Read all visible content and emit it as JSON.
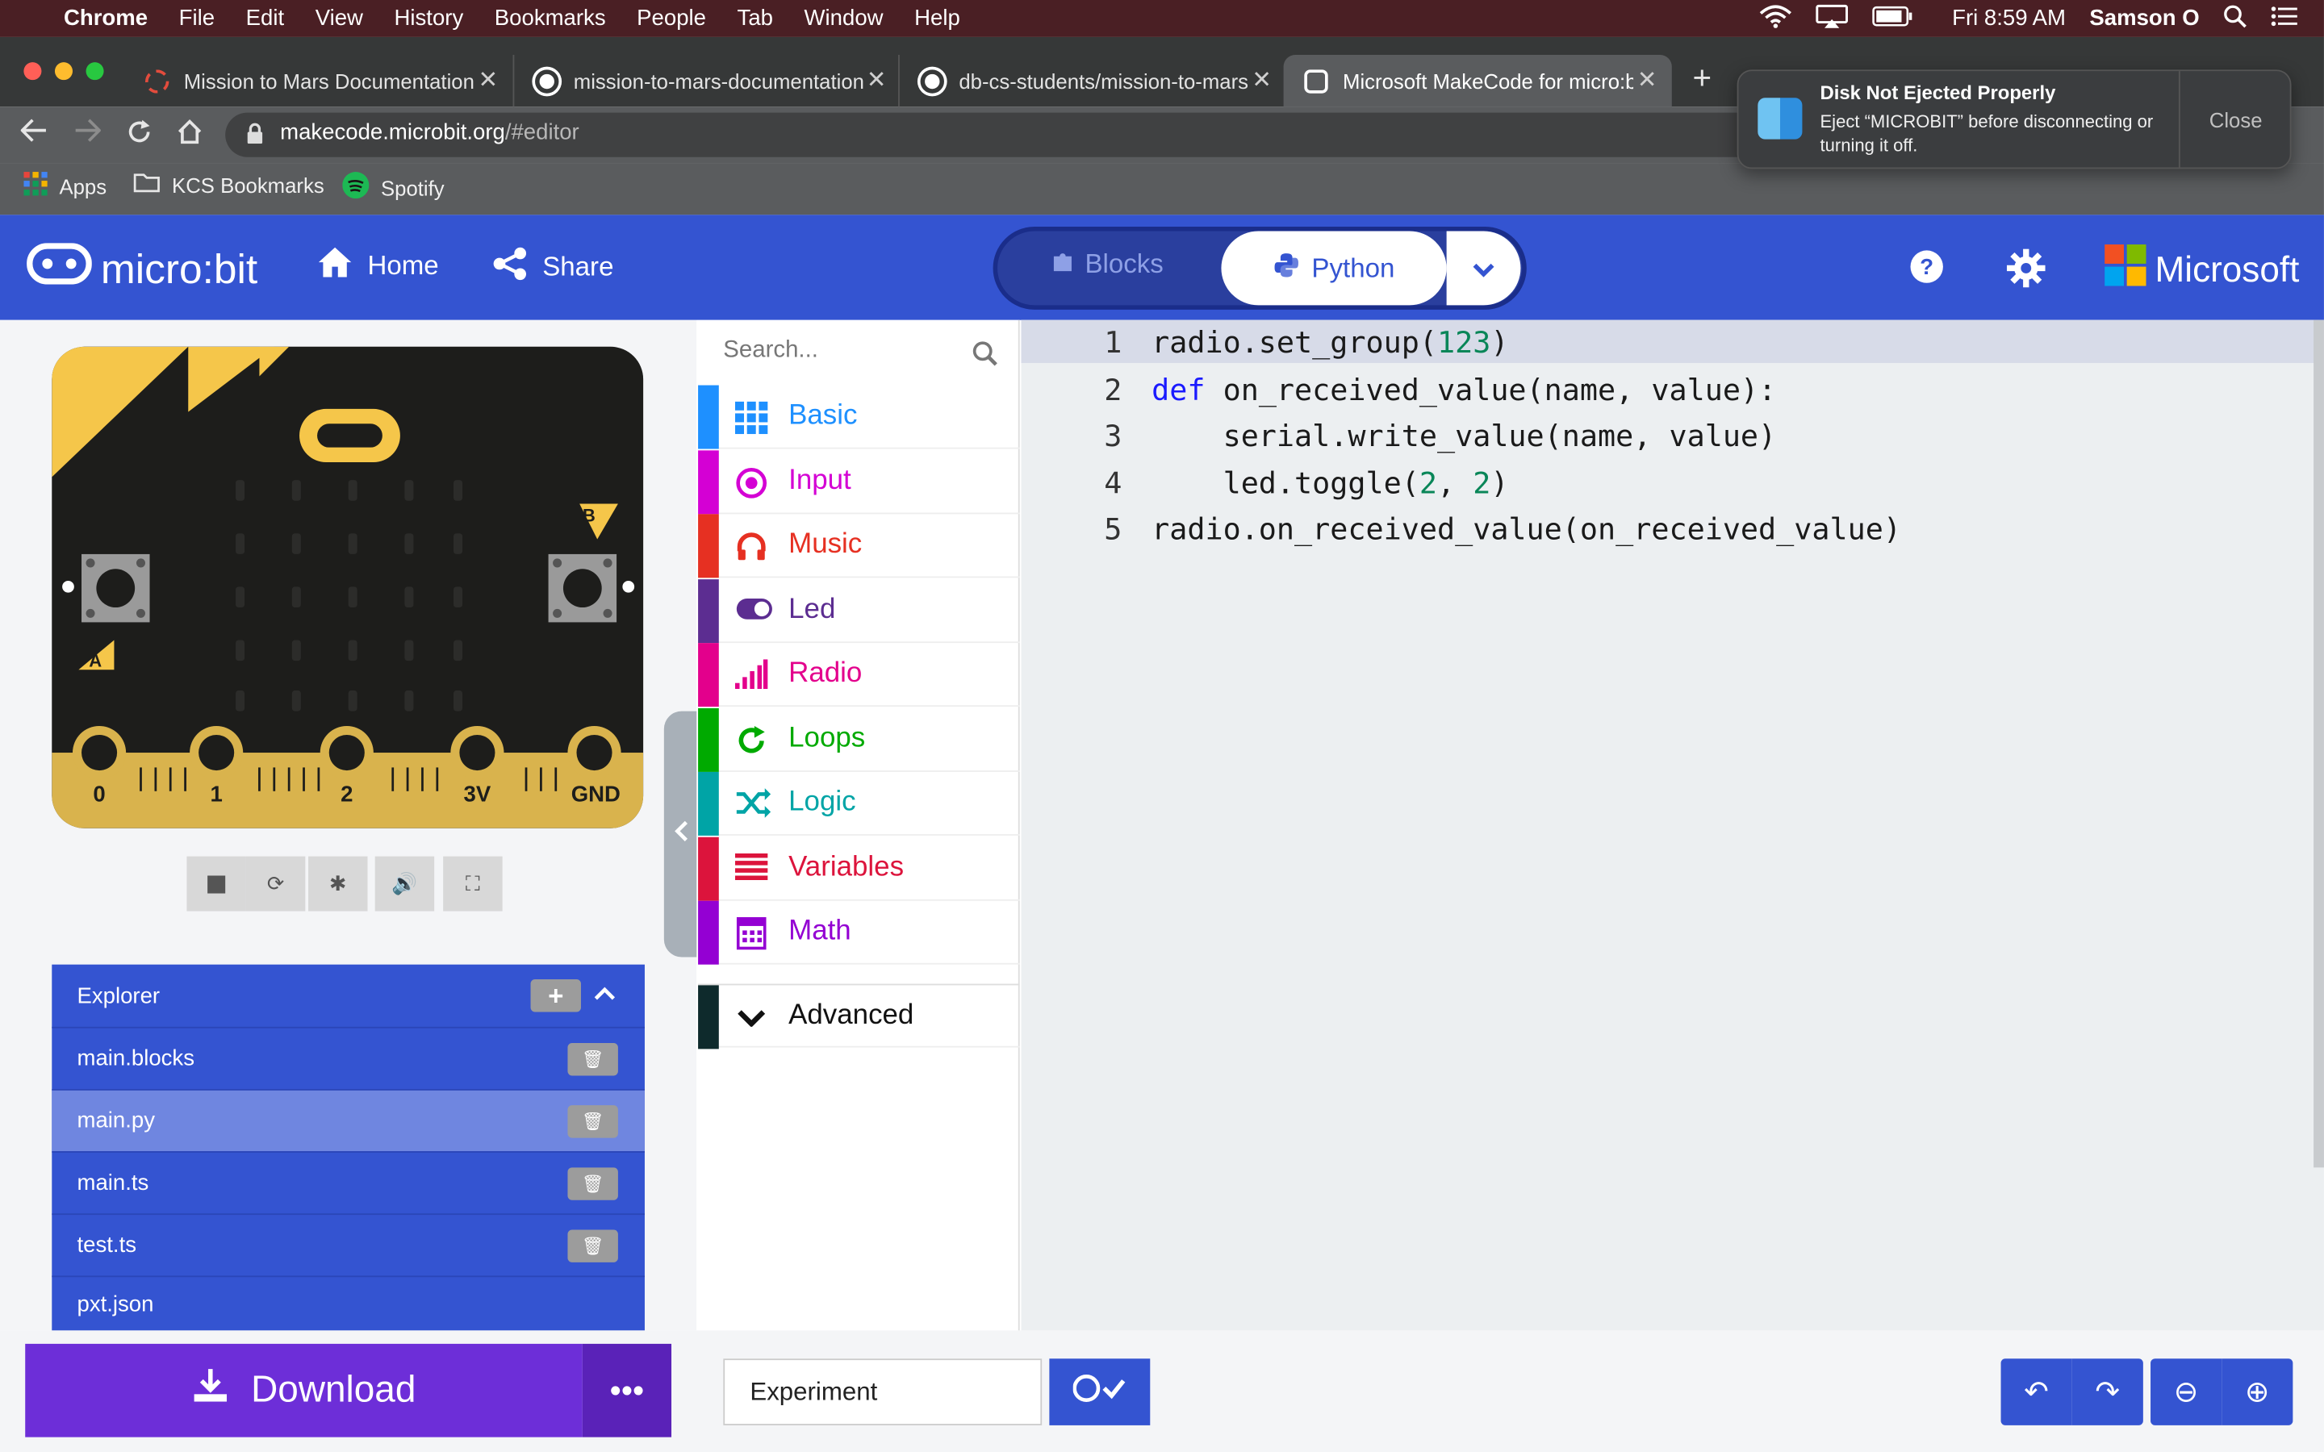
{
  "menubar": {
    "apple_icon": "apple-icon",
    "items": [
      "Chrome",
      "File",
      "Edit",
      "View",
      "History",
      "Bookmarks",
      "People",
      "Tab",
      "Window",
      "Help"
    ],
    "clock": "Fri 8:59 AM",
    "user": "Samson O"
  },
  "tabs": [
    {
      "title": "Mission to Mars Documentation",
      "icon": "gear-red-icon"
    },
    {
      "title": "mission-to-mars-documentation",
      "icon": "github-icon"
    },
    {
      "title": "db-cs-students/mission-to-mars",
      "icon": "github-icon"
    },
    {
      "title": "Microsoft MakeCode for micro:bit",
      "icon": "makecode-icon"
    }
  ],
  "address": {
    "host": "makecode.microbit.org",
    "path": "/#editor"
  },
  "bookmarks": [
    {
      "label": "Apps",
      "icon": "apps-grid-icon"
    },
    {
      "label": "KCS Bookmarks",
      "icon": "folder-icon"
    },
    {
      "label": "Spotify",
      "icon": "spotify-icon"
    }
  ],
  "notification": {
    "title": "Disk Not Ejected Properly",
    "body": "Eject “MICROBIT” before disconnecting or turning it off.",
    "close_label": "Close"
  },
  "header": {
    "logo": "micro:bit",
    "home": "Home",
    "share": "Share",
    "blocks": "Blocks",
    "python": "Python",
    "brand": "Microsoft"
  },
  "board": {
    "pins": [
      "0",
      "1",
      "2",
      "3V",
      "GND"
    ],
    "button_a": "A",
    "button_b": "B"
  },
  "explorer": {
    "title": "Explorer",
    "files": [
      "main.blocks",
      "main.py",
      "main.ts",
      "test.ts",
      "pxt.json"
    ],
    "selected": "main.py"
  },
  "toolbox": {
    "search_placeholder": "Search...",
    "categories": [
      {
        "label": "Basic",
        "color": "#1e90ff",
        "icon": "grid-icon"
      },
      {
        "label": "Input",
        "color": "#d400d4",
        "icon": "target-icon"
      },
      {
        "label": "Music",
        "color": "#e63022",
        "icon": "headphones-icon"
      },
      {
        "label": "Led",
        "color": "#5c2d91",
        "icon": "toggle-icon"
      },
      {
        "label": "Radio",
        "color": "#e3008c",
        "icon": "signal-icon"
      },
      {
        "label": "Loops",
        "color": "#00aa00",
        "icon": "refresh-icon"
      },
      {
        "label": "Logic",
        "color": "#00a4a6",
        "icon": "shuffle-icon"
      },
      {
        "label": "Variables",
        "color": "#dc143c",
        "icon": "lines-icon"
      },
      {
        "label": "Math",
        "color": "#9400d3",
        "icon": "calculator-icon"
      }
    ],
    "advanced": "Advanced"
  },
  "editor": {
    "line_numbers": [
      "1",
      "2",
      "3",
      "4",
      "5"
    ]
  },
  "bottom": {
    "download": "Download",
    "project_name": "Experiment"
  }
}
